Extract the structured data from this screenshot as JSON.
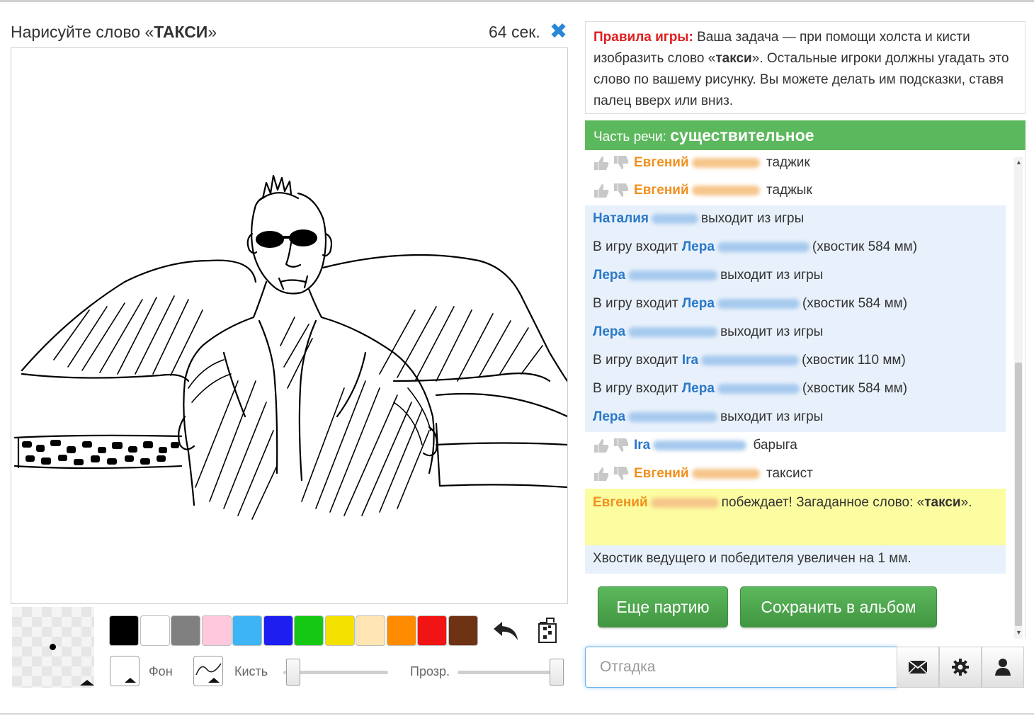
{
  "task": {
    "prefix": "Нарисуйте слово «",
    "word": "ТАКСИ",
    "suffix": "»"
  },
  "timer": "64 сек.",
  "rules": {
    "title": "Правила игры:",
    "text_1": " Ваша задача — при помощи холста и кисти изобразить слово «",
    "word": "такси",
    "text_2": "». Остальные игроки должны угадать это слово по вашему рисунку. Вы можете делать им подсказки, ставя палец вверх или вниз."
  },
  "part_of_speech": {
    "label": "Часть речи: ",
    "value": "существительное"
  },
  "chat": {
    "m1": {
      "name": "Евгений",
      "text": " таджик"
    },
    "m2": {
      "name": "Евгений",
      "text": " таджык"
    },
    "m3": {
      "name": "Наталия",
      "text": "выходит из игры"
    },
    "m4": {
      "prefix": "В игру входит ",
      "name": "Лера",
      "text": "(хвостик 584 мм)"
    },
    "m5": {
      "name": "Лера",
      "text": "выходит из игры"
    },
    "m6": {
      "prefix": "В игру входит ",
      "name": "Лера",
      "text": "(хвостик 584 мм)"
    },
    "m7": {
      "name": "Лера",
      "text": "выходит из игры"
    },
    "m8": {
      "prefix": "В игру входит ",
      "name": "Ira",
      "text": "(хвостик 110 мм)"
    },
    "m9": {
      "prefix": "В игру входит ",
      "name": "Лера",
      "text": "(хвостик 584 мм)"
    },
    "m10": {
      "name": "Лера",
      "text": "выходит из игры"
    },
    "m11": {
      "name": "Ira",
      "text": " барыга"
    },
    "m12": {
      "name": "Евгений",
      "text": " таксист"
    },
    "win": {
      "name": "Евгений",
      "text_1": "побеждает! Загаданное слово: «",
      "word": "такси",
      "text_2": "»."
    },
    "m14": {
      "text": "Хвостик ведущего и победителя увеличен на 1 мм."
    }
  },
  "buttons": {
    "more": "Еще партию",
    "save": "Сохранить в альбом"
  },
  "guess": {
    "placeholder": "Отгадка"
  },
  "tools": {
    "bg_label": "Фон",
    "brush_label": "Кисть",
    "opacity_label": "Прозр."
  },
  "palette": [
    "#000000",
    "#ffffff",
    "#808080",
    "#ffc8dc",
    "#3cb4f5",
    "#1e1ef0",
    "#14c814",
    "#f5e100",
    "#ffe6b4",
    "#ff8c00",
    "#f01414",
    "#6e3214"
  ],
  "colors": {
    "accent_green": "#5cb85c",
    "accent_blue": "#2a86d6",
    "rules_red": "#e02020",
    "name_orange": "#f0901e",
    "name_blue": "#2a78c8"
  }
}
